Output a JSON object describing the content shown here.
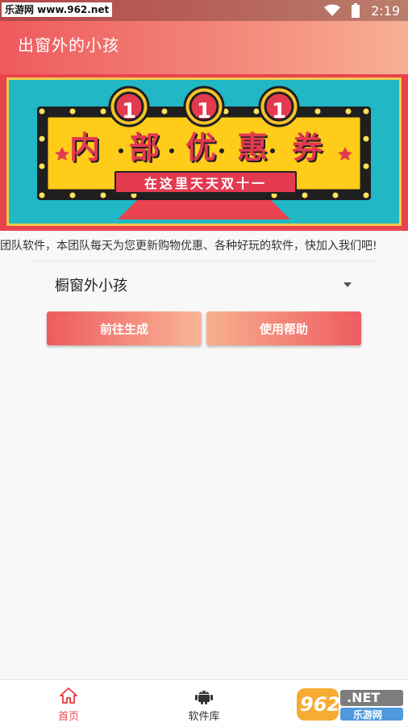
{
  "status_bar": {
    "watermark": "乐游网 www.962.net",
    "time": "2:19"
  },
  "header": {
    "title": "出窗外的小孩"
  },
  "banner": {
    "top_digits": [
      "1",
      "1",
      "1"
    ],
    "chars": [
      "内",
      "部",
      "优",
      "惠",
      "券"
    ],
    "tagline": "在这里天天双十一"
  },
  "ticker": {
    "text": "本团队软件，本团队每天为您更新购物优惠、各种好玩的软件，快加入我们吧!"
  },
  "select": {
    "value": "橱窗外小孩"
  },
  "buttons": {
    "generate": "前往生成",
    "help": "使用帮助"
  },
  "bottom_nav": {
    "items": [
      {
        "label": "首页",
        "icon": "home-icon",
        "active": true
      },
      {
        "label": "软件库",
        "icon": "android-icon",
        "active": false
      }
    ]
  },
  "watermark_logo": {
    "text_main": "962",
    "text_net": ".NET",
    "text_cn": "乐游网"
  },
  "colors": {
    "accent": "#ec4b50",
    "accent_light": "#f8b095",
    "banner_teal": "#22b7c5",
    "banner_yellow": "#ffcc1a"
  }
}
